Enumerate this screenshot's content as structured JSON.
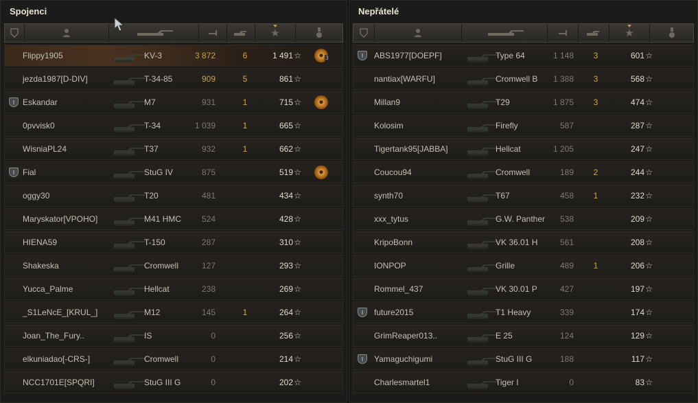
{
  "allies": {
    "title": "Spojenci",
    "rows": [
      {
        "name": "Flippy1905",
        "tank": "KV-3",
        "damage": "3 872",
        "kills": "6",
        "xp": "1 491",
        "medal": true,
        "medal_count": "3",
        "me": true,
        "hi": true
      },
      {
        "name": "jezda1987[D-DIV]",
        "tank": "T-34-85",
        "damage": "909",
        "kills": "5",
        "xp": "861",
        "hi": true
      },
      {
        "name": "Eskandar",
        "tank": "M7",
        "damage": "931",
        "kills": "1",
        "xp": "715",
        "medal": true,
        "badge": true
      },
      {
        "name": "0pvvisk0",
        "tank": "T-34",
        "damage": "1 039",
        "kills": "1",
        "xp": "665"
      },
      {
        "name": "WisniaPL24",
        "tank": "T37",
        "damage": "932",
        "kills": "1",
        "xp": "662"
      },
      {
        "name": "Fial",
        "tank": "StuG IV",
        "damage": "875",
        "kills": "",
        "xp": "519",
        "medal": true,
        "badge": true
      },
      {
        "name": "oggy30",
        "tank": "T20",
        "damage": "481",
        "kills": "",
        "xp": "434"
      },
      {
        "name": "Maryskator[VPOHO]",
        "tank": "M41 HMC",
        "damage": "524",
        "kills": "",
        "xp": "428"
      },
      {
        "name": "HIENA59",
        "tank": "T-150",
        "damage": "287",
        "kills": "",
        "xp": "310"
      },
      {
        "name": "Shakeska",
        "tank": "Cromwell",
        "damage": "127",
        "kills": "",
        "xp": "293"
      },
      {
        "name": "Yucca_Palme",
        "tank": "Hellcat",
        "damage": "238",
        "kills": "",
        "xp": "269"
      },
      {
        "name": "_S1LeNcE_[KRUL_]",
        "tank": "M12",
        "damage": "145",
        "kills": "1",
        "xp": "264"
      },
      {
        "name": "Joan_The_Fury..",
        "tank": "IS",
        "damage": "0",
        "kills": "",
        "xp": "256"
      },
      {
        "name": "elkuniadao[-CRS-]",
        "tank": "Cromwell",
        "damage": "0",
        "kills": "",
        "xp": "214"
      },
      {
        "name": "NCC1701E[SPQRI]",
        "tank": "StuG III G",
        "damage": "0",
        "kills": "",
        "xp": "202"
      }
    ]
  },
  "enemies": {
    "title": "Nepřátelé",
    "rows": [
      {
        "name": "ABS1977[DOEPF]",
        "tank": "Type 64",
        "damage": "1 148",
        "kills": "3",
        "xp": "601",
        "badge": true
      },
      {
        "name": "nantiax[WARFU]",
        "tank": "Cromwell B",
        "damage": "1 388",
        "kills": "3",
        "xp": "568"
      },
      {
        "name": "Millan9",
        "tank": "T29",
        "damage": "1 875",
        "kills": "3",
        "xp": "474"
      },
      {
        "name": "Kolosim",
        "tank": "Firefly",
        "damage": "587",
        "kills": "",
        "xp": "287"
      },
      {
        "name": "Tigertank95[JABBA]",
        "tank": "Hellcat",
        "damage": "1 205",
        "kills": "",
        "xp": "247"
      },
      {
        "name": "Coucou94",
        "tank": "Cromwell",
        "damage": "189",
        "kills": "2",
        "xp": "244"
      },
      {
        "name": "synth70",
        "tank": "T67",
        "damage": "458",
        "kills": "1",
        "xp": "232"
      },
      {
        "name": "xxx_tytus",
        "tank": "G.W. Panther",
        "damage": "538",
        "kills": "",
        "xp": "209"
      },
      {
        "name": "KripoBonn",
        "tank": "VK 36.01 H",
        "damage": "561",
        "kills": "",
        "xp": "208"
      },
      {
        "name": "IONPOP",
        "tank": "Grille",
        "damage": "489",
        "kills": "1",
        "xp": "206"
      },
      {
        "name": "Rommel_437",
        "tank": "VK 30.01 P",
        "damage": "427",
        "kills": "",
        "xp": "197"
      },
      {
        "name": "future2015",
        "tank": "T1 Heavy",
        "damage": "339",
        "kills": "",
        "xp": "174",
        "badge": true
      },
      {
        "name": "GrimReaper013..",
        "tank": "E 25",
        "damage": "124",
        "kills": "",
        "xp": "129"
      },
      {
        "name": "Yamaguchigumi",
        "tank": "StuG III G",
        "damage": "188",
        "kills": "",
        "xp": "117",
        "badge": true
      },
      {
        "name": "Charlesmartel1",
        "tank": "Tiger I",
        "damage": "0",
        "kills": "",
        "xp": "83"
      }
    ]
  },
  "colors": {
    "accent": "#d8a830",
    "damage_high": "#c8a048",
    "panel": "#1d1b19"
  },
  "icons": [
    "badge-icon",
    "player-icon",
    "tank-icon",
    "damage-icon",
    "kills-icon",
    "xp-star-icon",
    "medal-icon",
    "platoon-badge-icon",
    "star-icon",
    "cursor-icon"
  ]
}
